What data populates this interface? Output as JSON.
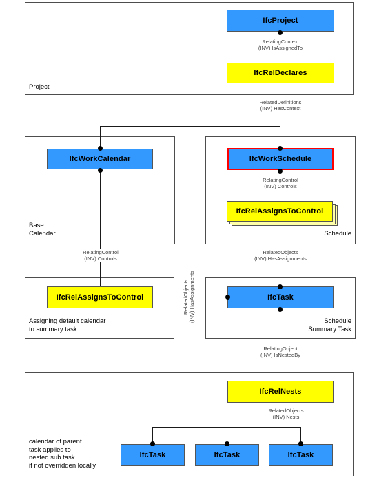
{
  "diagram": {
    "title": "IfcWorkCalendar assignment concept diagram",
    "colors": {
      "entity_fill": "#3399ff",
      "relationship_fill": "#ffff00",
      "stack_fill": "#ffffaa",
      "highlight_border": "#ff0000",
      "line": "#1a1a1a",
      "label_text": "#404040",
      "container_border": "#4d4d4d"
    }
  },
  "groups": [
    {
      "id": "project",
      "label": "Project",
      "label_align": "left"
    },
    {
      "id": "base_calendar",
      "label": "Base\nCalendar",
      "label_align": "left"
    },
    {
      "id": "schedule",
      "label": "Schedule",
      "label_align": "right"
    },
    {
      "id": "assigning_default_calendar",
      "label": "Assigning default calendar\nto summary task",
      "label_align": "left"
    },
    {
      "id": "schedule_summary_task",
      "label": "Schedule\nSummary Task",
      "label_align": "right"
    },
    {
      "id": "nesting",
      "label": "calendar of parent\ntask applies to\nnested sub task\nif not overridden locally",
      "label_align": "left"
    }
  ],
  "nodes": {
    "ifc_project": "IfcProject",
    "ifc_rel_declares": "IfcRelDeclares",
    "ifc_work_calendar": "IfcWorkCalendar",
    "ifc_work_schedule": "IfcWorkSchedule",
    "ifc_rel_assigns_to_control_schedule": "IfcRelAssignsToControl",
    "ifc_rel_assigns_to_control_calendar": "IfcRelAssignsToControl",
    "ifc_task_summary": "IfcTask",
    "ifc_rel_nests": "IfcRelNests",
    "ifc_task_sub_1": "IfcTask",
    "ifc_task_sub_2": "IfcTask",
    "ifc_task_sub_3": "IfcTask"
  },
  "edge_labels": {
    "relating_context": "RelatingContext\n(INV) IsAssignedTo",
    "related_definitions": "RelatedDefinitions\n(INV) HasContext",
    "relating_control_schedule": "RelatingControl\n(INV) Controls",
    "relating_control_calendar": "RelatingControl\n(INV) Controls",
    "related_objects_task": "RelatedObjects\n(INV) HasAssignments",
    "related_objects_vertical": "RelatedObjects\n(INV) HasAssignments",
    "relating_object": "RelatingObject\n(INV) IsNestedBy",
    "related_objects_nests": "RelatedObjects\n(INV) Nests"
  }
}
